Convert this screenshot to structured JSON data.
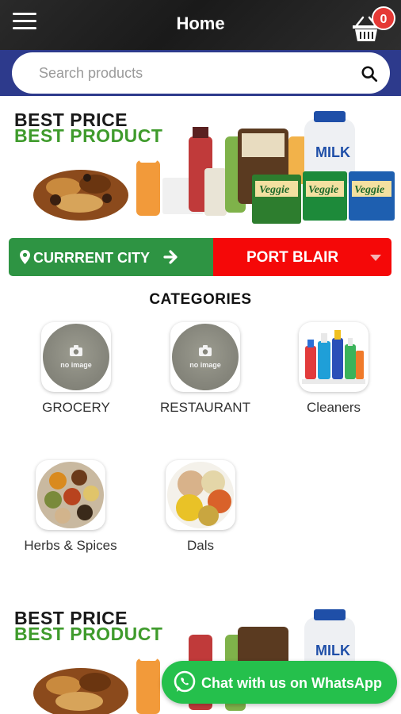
{
  "header": {
    "title": "Home",
    "cart_count": "0",
    "menu_icon": "hamburger-menu-icon",
    "cart_icon": "shopping-basket-icon"
  },
  "search": {
    "placeholder": "Search products",
    "value": "",
    "icon": "search-icon"
  },
  "banner": {
    "line1": "BEST PRICE",
    "line2": "BEST PRODUCT",
    "packet_label": "Veggie",
    "milk_label": "MILK"
  },
  "city": {
    "label": "CURRRENT CITY",
    "selected": "PORT BLAIR",
    "pin_icon": "map-pin-icon",
    "arrow_icon": "arrow-right-icon"
  },
  "categories": {
    "title": "CATEGORIES",
    "no_image_text": "no image",
    "items": [
      {
        "label": "GROCERY"
      },
      {
        "label": "RESTAURANT"
      },
      {
        "label": "Cleaners"
      },
      {
        "label": "Herbs & Spices"
      },
      {
        "label": "Dals"
      }
    ]
  },
  "whatsapp": {
    "label": "Chat with us on WhatsApp",
    "icon": "whatsapp-icon"
  },
  "colors": {
    "header_bg": "#222222",
    "search_band": "#2d3a8c",
    "city_green": "#2e9443",
    "city_red": "#f50808",
    "badge_red": "#e53935",
    "whatsapp_green": "#25c04c",
    "best_product_green": "#3f9b2c"
  }
}
